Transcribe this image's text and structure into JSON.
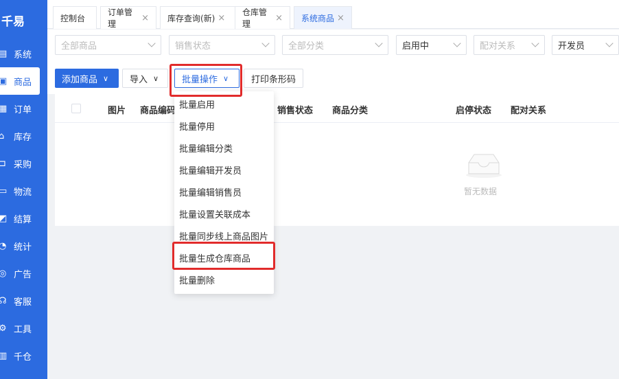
{
  "app": {
    "logo": "千易"
  },
  "sidebar": {
    "items": [
      {
        "icon": "▤",
        "label": "系统"
      },
      {
        "icon": "▣",
        "label": "商品",
        "active": true
      },
      {
        "icon": "▦",
        "label": "订单"
      },
      {
        "icon": "⌂",
        "label": "库存"
      },
      {
        "icon": "⊐",
        "label": "采购"
      },
      {
        "icon": "▭",
        "label": "物流"
      },
      {
        "icon": "◩",
        "label": "结算"
      },
      {
        "icon": "◔",
        "label": "统计"
      },
      {
        "icon": "◎",
        "label": "广告"
      },
      {
        "icon": "☊",
        "label": "客服"
      },
      {
        "icon": "⚙",
        "label": "工具"
      },
      {
        "icon": "▥",
        "label": "千仓"
      }
    ]
  },
  "tabs": [
    {
      "label": "控制台",
      "closable": false
    },
    {
      "label": "订单管理",
      "closable": true
    },
    {
      "label": "库存查询(新)",
      "closable": true
    },
    {
      "label": "仓库管理",
      "closable": true
    },
    {
      "label": "系统商品",
      "closable": true,
      "active": true
    }
  ],
  "tab_close": "×",
  "filters": [
    {
      "value": "全部商品",
      "filled": false
    },
    {
      "value": "销售状态",
      "filled": false
    },
    {
      "value": "全部分类",
      "filled": false
    },
    {
      "value": "启用中",
      "filled": true
    },
    {
      "value": "配对关系",
      "filled": false
    },
    {
      "value": "开发员",
      "filled": true
    }
  ],
  "toolbar": {
    "add_label": "添加商品",
    "import_label": "导入",
    "batch_label": "批量操作",
    "print_label": "打印条形码"
  },
  "table": {
    "columns": [
      "图片",
      "商品编码",
      "销售状态",
      "商品分类",
      "启停状态",
      "配对关系"
    ],
    "empty_text": "暂无数据"
  },
  "batch_menu": {
    "items": [
      "批量启用",
      "批量停用",
      "批量编辑分类",
      "批量编辑开发员",
      "批量编辑销售员",
      "批量设置关联成本",
      "批量同步线上商品图片",
      "批量生成仓库商品",
      "批量删除"
    ]
  },
  "colors": {
    "primary": "#2c6be0",
    "highlight": "#e12b2b"
  }
}
